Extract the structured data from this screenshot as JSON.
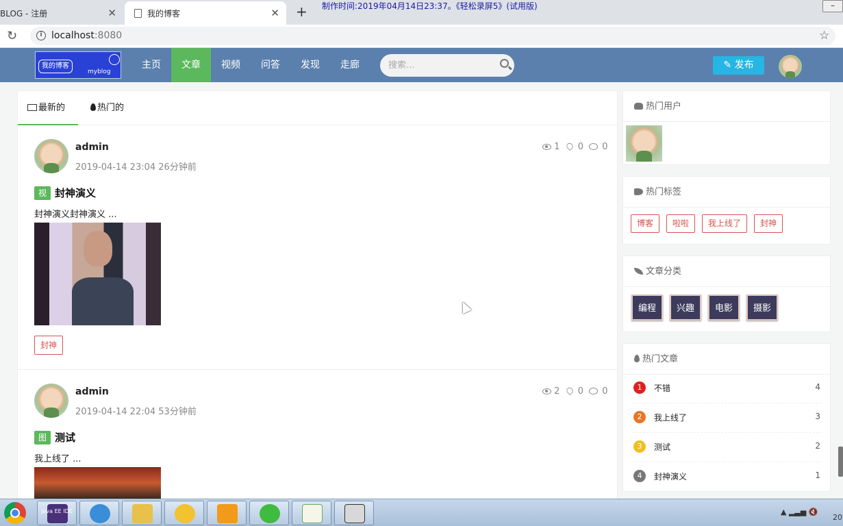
{
  "browser": {
    "tabs": [
      {
        "title": "BLOG - 注册",
        "active": false
      },
      {
        "title": "我的博客",
        "active": true
      }
    ],
    "url_host": "localhost",
    "url_port": ":8080",
    "recorder_note": "制作时间:2019年04月14日23:37。《轻松录屏5》(试用版)"
  },
  "nav": {
    "logo_badge": "我的博客",
    "logo_sub": "myblog",
    "items": [
      {
        "label": "主页",
        "active": false
      },
      {
        "label": "文章",
        "active": true
      },
      {
        "label": "视频",
        "active": false
      },
      {
        "label": "问答",
        "active": false
      },
      {
        "label": "发现",
        "active": false
      },
      {
        "label": "走廊",
        "active": false
      }
    ],
    "search_placeholder": "搜索...",
    "publish_label": "发布"
  },
  "main": {
    "tabs": [
      {
        "label": "最新的",
        "active": true
      },
      {
        "label": "热门的",
        "active": false
      }
    ],
    "posts": [
      {
        "author": "admin",
        "time": "2019-04-14 23:04 26分钟前",
        "views": "1",
        "likes": "0",
        "comments": "0",
        "type_badge": "视",
        "title": "封神演义",
        "excerpt": "封神演义封神演义 ...",
        "tag": "封神"
      },
      {
        "author": "admin",
        "time": "2019-04-14 22:04 53分钟前",
        "views": "2",
        "likes": "0",
        "comments": "0",
        "type_badge": "图",
        "title": "测试",
        "excerpt": "我上线了 ..."
      }
    ]
  },
  "sidebar": {
    "hot_users_title": "热门用户",
    "hot_tags_title": "热门标签",
    "hot_tags": [
      "博客",
      "啦啦",
      "我上线了",
      "封神"
    ],
    "categories_title": "文章分类",
    "categories": [
      "编程",
      "兴趣",
      "电影",
      "摄影"
    ],
    "hot_articles_title": "热门文章",
    "hot_articles": [
      {
        "rank": "1",
        "name": "不错",
        "count": "4",
        "color": "#e02020"
      },
      {
        "rank": "2",
        "name": "我上线了",
        "count": "3",
        "color": "#e8762b"
      },
      {
        "rank": "3",
        "name": "测试",
        "count": "2",
        "color": "#f0c020"
      },
      {
        "rank": "4",
        "name": "封神演义",
        "count": "1",
        "color": "#777777"
      }
    ]
  },
  "taskbar": {
    "java_label": "Java EE IDE",
    "clock": "20"
  },
  "colors": {
    "nav_bg": "#5b80ad",
    "accent_green": "#5cb85c",
    "publish_blue": "#27b5e3",
    "tag_red": "#d9534f",
    "category_bg": "#3d3b5c"
  }
}
